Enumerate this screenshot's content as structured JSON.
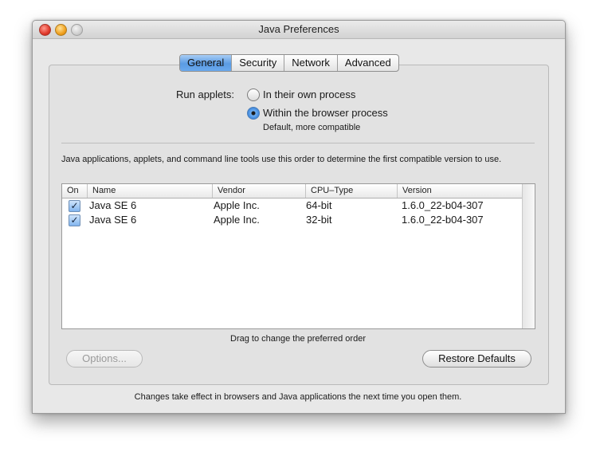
{
  "window": {
    "title": "Java Preferences"
  },
  "tabs": [
    "General",
    "Security",
    "Network",
    "Advanced"
  ],
  "run_applets": {
    "label": "Run applets:",
    "option_own": "In their own process",
    "option_browser": "Within the browser process",
    "option_browser_note": "Default, more compatible",
    "selected": "option_browser"
  },
  "description": "Java applications, applets, and command line tools use this order to determine the first compatible version to use.",
  "table": {
    "headers": {
      "on": "On",
      "name": "Name",
      "vendor": "Vendor",
      "cpu": "CPU–Type",
      "version": "Version"
    },
    "rows": [
      {
        "on": true,
        "name": "Java SE 6",
        "vendor": "Apple Inc.",
        "cpu": "64-bit",
        "version": "1.6.0_22-b04-307"
      },
      {
        "on": true,
        "name": "Java SE 6",
        "vendor": "Apple Inc.",
        "cpu": "32-bit",
        "version": "1.6.0_22-b04-307"
      }
    ]
  },
  "drag_hint": "Drag to change the preferred order",
  "buttons": {
    "options": "Options...",
    "restore": "Restore Defaults"
  },
  "footer": "Changes take effect in browsers and Java applications the next time you open them."
}
